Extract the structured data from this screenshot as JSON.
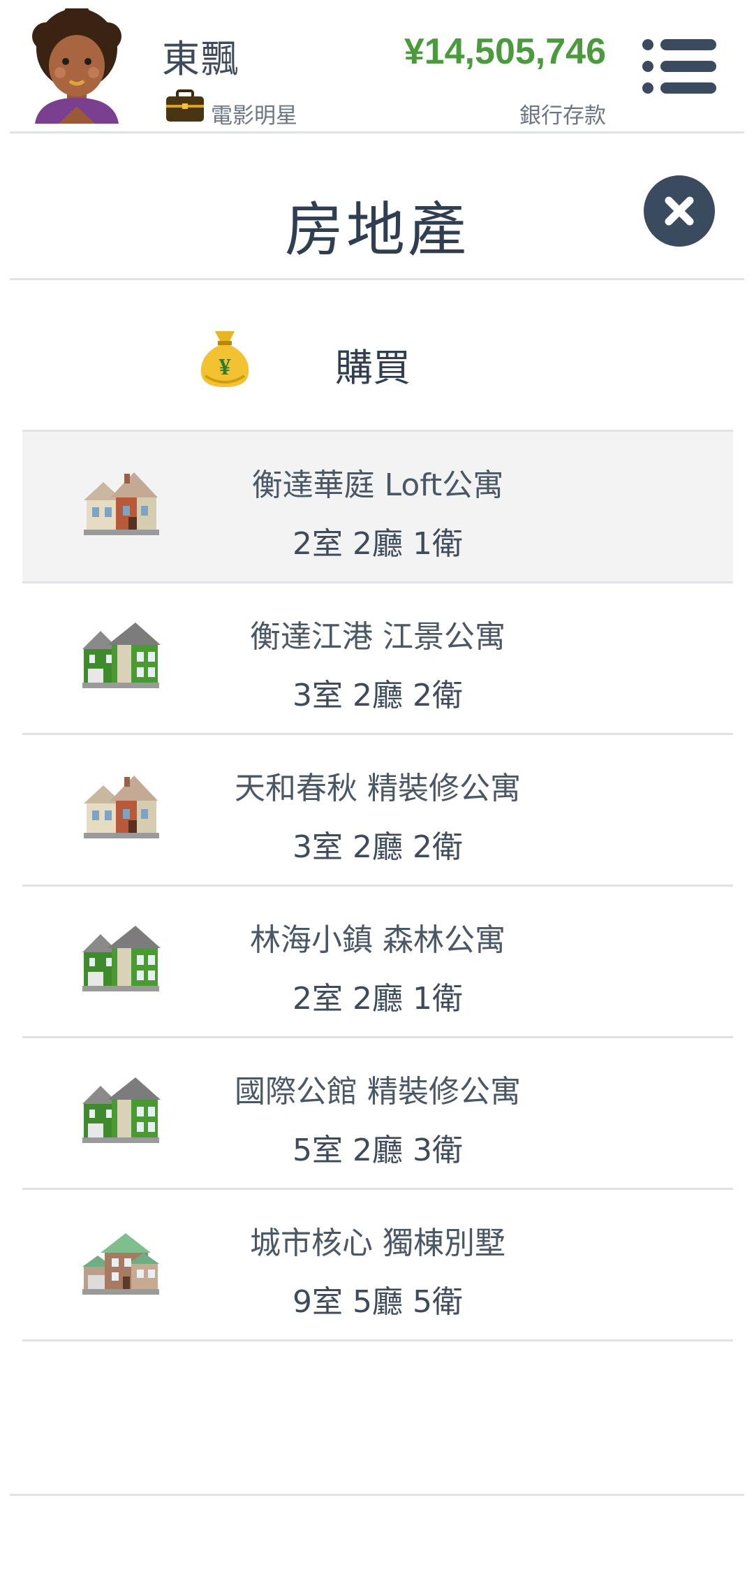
{
  "header": {
    "player_name": "東飄",
    "job": "電影明星",
    "money": "¥14,505,746",
    "money_label": "銀行存款",
    "avatar": "avatar-portrait",
    "job_icon": "briefcase-icon",
    "menu_icon": "menu-list-icon"
  },
  "panel": {
    "title": "房地產",
    "close_icon": "close-icon"
  },
  "buy": {
    "label": "購買",
    "icon": "money-bag-icon"
  },
  "properties": [
    {
      "name": "衡達華庭 Loft公寓",
      "rooms": "2室 2廳 1衛",
      "icon": "house-tan-icon",
      "selected": true
    },
    {
      "name": "衡達江港 江景公寓",
      "rooms": "3室 2廳 2衛",
      "icon": "house-green-icon",
      "selected": false
    },
    {
      "name": "天和春秋 精裝修公寓",
      "rooms": "3室 2廳 2衛",
      "icon": "house-tan-icon",
      "selected": false
    },
    {
      "name": "林海小鎮 森林公寓",
      "rooms": "2室 2廳 1衛",
      "icon": "house-green-icon",
      "selected": false
    },
    {
      "name": "國際公館 精裝修公寓",
      "rooms": "5室 2廳 3衛",
      "icon": "house-green-icon",
      "selected": false
    },
    {
      "name": "城市核心 獨棟別墅",
      "rooms": "9室 5廳 5衛",
      "icon": "villa-icon",
      "selected": false
    }
  ],
  "colors": {
    "money": "#4c9a3e",
    "dark": "#3a4b5f",
    "divider": "#dfe3e6",
    "selected_row": "#f3f3f3"
  }
}
